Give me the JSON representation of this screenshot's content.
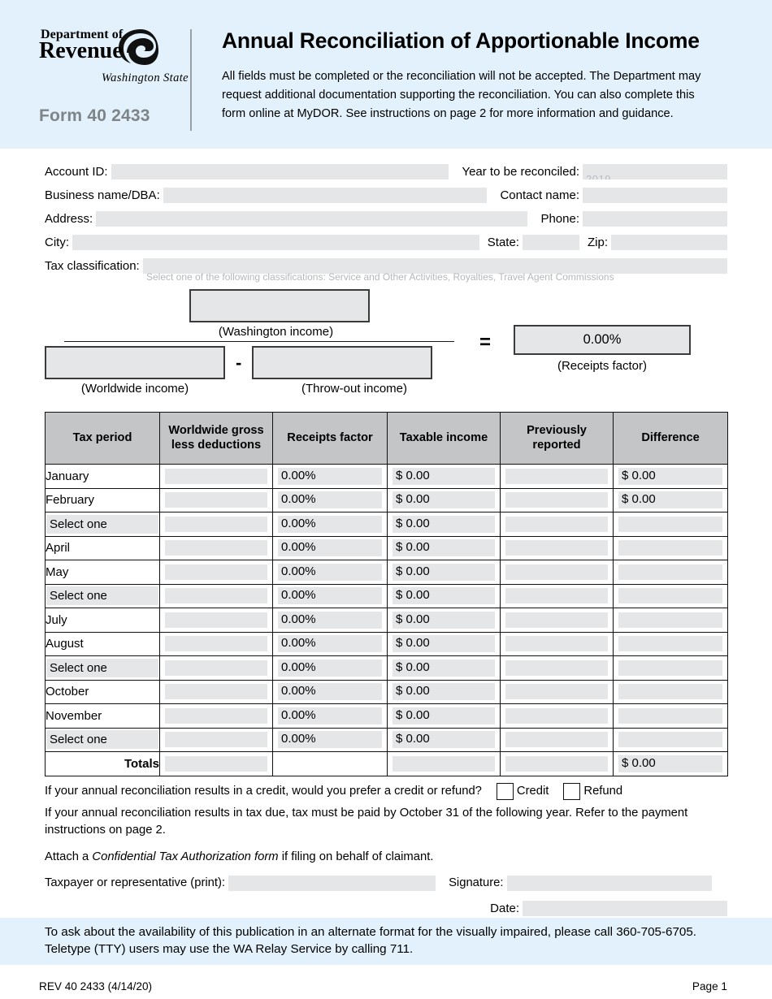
{
  "header": {
    "logo": {
      "dept_of": "Department of",
      "revenue": "Revenue",
      "state": "Washington State",
      "icon": "dor-swirl-logo"
    },
    "form_number": "Form 40 2433",
    "title": "Annual Reconciliation of Apportionable Income",
    "description": "All fields must be completed or the reconciliation will not be accepted. The Department may request additional documentation supporting the reconciliation. You can also complete this form online at MyDOR. See instructions on page 2 for more information and guidance."
  },
  "fields": {
    "account_id_label": "Account ID:",
    "account_id_value": "",
    "year_label": "Year to be reconciled:",
    "year_value": "",
    "business_name_label": "Business name/DBA:",
    "business_name_value": "",
    "contact_name_label": "Contact name:",
    "contact_name_value": "",
    "address_label": "Address:",
    "address_value": "",
    "phone_label": "Phone:",
    "phone_value": "",
    "city_label": "City:",
    "city_value": "",
    "state_label": "State:",
    "state_value": "",
    "zip_label": "Zip:",
    "zip_value": "",
    "tax_classification_label": "Tax classification:",
    "tax_classification_value": ""
  },
  "formula": {
    "washington_income_value": "",
    "washington_income_caption": "(Washington income)",
    "worldwide_income_value": "",
    "worldwide_income_caption": "(Worldwide income)",
    "minus_operator": "-",
    "throwout_income_value": "",
    "throwout_income_caption": "(Throw-out income)",
    "equals_operator": "=",
    "receipts_factor_value": "0.00%",
    "receipts_factor_caption": "(Receipts factor)"
  },
  "table": {
    "columns": [
      "Tax period",
      "Worldwide gross less deductions",
      "Receipts factor",
      "Taxable income",
      "Previously reported",
      "Difference"
    ],
    "rows": [
      {
        "period": "January",
        "is_select": false,
        "gross": "",
        "factor": "0.00%",
        "taxable": "$ 0.00",
        "previously": "",
        "difference": "$ 0.00"
      },
      {
        "period": "February",
        "is_select": false,
        "gross": "",
        "factor": "0.00%",
        "taxable": "$ 0.00",
        "previously": "",
        "difference": "$ 0.00"
      },
      {
        "period": "Select one",
        "is_select": true,
        "gross": "",
        "factor": "0.00%",
        "taxable": "$ 0.00",
        "previously": "",
        "difference": ""
      },
      {
        "period": "April",
        "is_select": false,
        "gross": "",
        "factor": "0.00%",
        "taxable": "$ 0.00",
        "previously": "",
        "difference": ""
      },
      {
        "period": "May",
        "is_select": false,
        "gross": "",
        "factor": "0.00%",
        "taxable": "$ 0.00",
        "previously": "",
        "difference": ""
      },
      {
        "period": "Select one",
        "is_select": true,
        "gross": "",
        "factor": "0.00%",
        "taxable": "$ 0.00",
        "previously": "",
        "difference": ""
      },
      {
        "period": "July",
        "is_select": false,
        "gross": "",
        "factor": "0.00%",
        "taxable": "$ 0.00",
        "previously": "",
        "difference": ""
      },
      {
        "period": "August",
        "is_select": false,
        "gross": "",
        "factor": "0.00%",
        "taxable": "$ 0.00",
        "previously": "",
        "difference": ""
      },
      {
        "period": "Select one",
        "is_select": true,
        "gross": "",
        "factor": "0.00%",
        "taxable": "$ 0.00",
        "previously": "",
        "difference": ""
      },
      {
        "period": "October",
        "is_select": false,
        "gross": "",
        "factor": "0.00%",
        "taxable": "$ 0.00",
        "previously": "",
        "difference": ""
      },
      {
        "period": "November",
        "is_select": false,
        "gross": "",
        "factor": "0.00%",
        "taxable": "$ 0.00",
        "previously": "",
        "difference": ""
      },
      {
        "period": "Select one",
        "is_select": true,
        "gross": "",
        "factor": "0.00%",
        "taxable": "$ 0.00",
        "previously": "",
        "difference": ""
      }
    ],
    "totals": {
      "label": "Totals",
      "gross": "",
      "factor": null,
      "taxable": "",
      "previously": "",
      "difference": "$ 0.00"
    }
  },
  "notes": {
    "credit_question": "If your annual reconciliation results in a credit, would you prefer a credit or refund?",
    "credit_option": "Credit",
    "refund_option": "Refund",
    "tax_due_note": "If your annual reconciliation results in tax due, tax must be paid by October 31 of the following year. Refer to the payment instructions on page 2.",
    "attach_prefix": "Attach a ",
    "attach_italic": "Confidential Tax Authorization form",
    "attach_suffix": " if filing on behalf of claimant.",
    "taxpayer_label": "Taxpayer or representative (print):",
    "taxpayer_value": "",
    "signature_label": "Signature:",
    "signature_value": "",
    "date_label": "Date:",
    "date_value": ""
  },
  "footer": {
    "accessibility_note": "To ask about the availability of this publication in an alternate format for the visually impaired, please call 360-705-6705. Teletype (TTY) users may use the WA Relay Service by calling 711.",
    "revision": "REV 40 2433  (4/14/20)",
    "page": "Page 1"
  },
  "colors": {
    "band_blue": "#e2f1fb",
    "field_gray": "#e4e6e8",
    "table_header_gray": "#c3c5c7",
    "form_number_gray": "#7e8487"
  }
}
